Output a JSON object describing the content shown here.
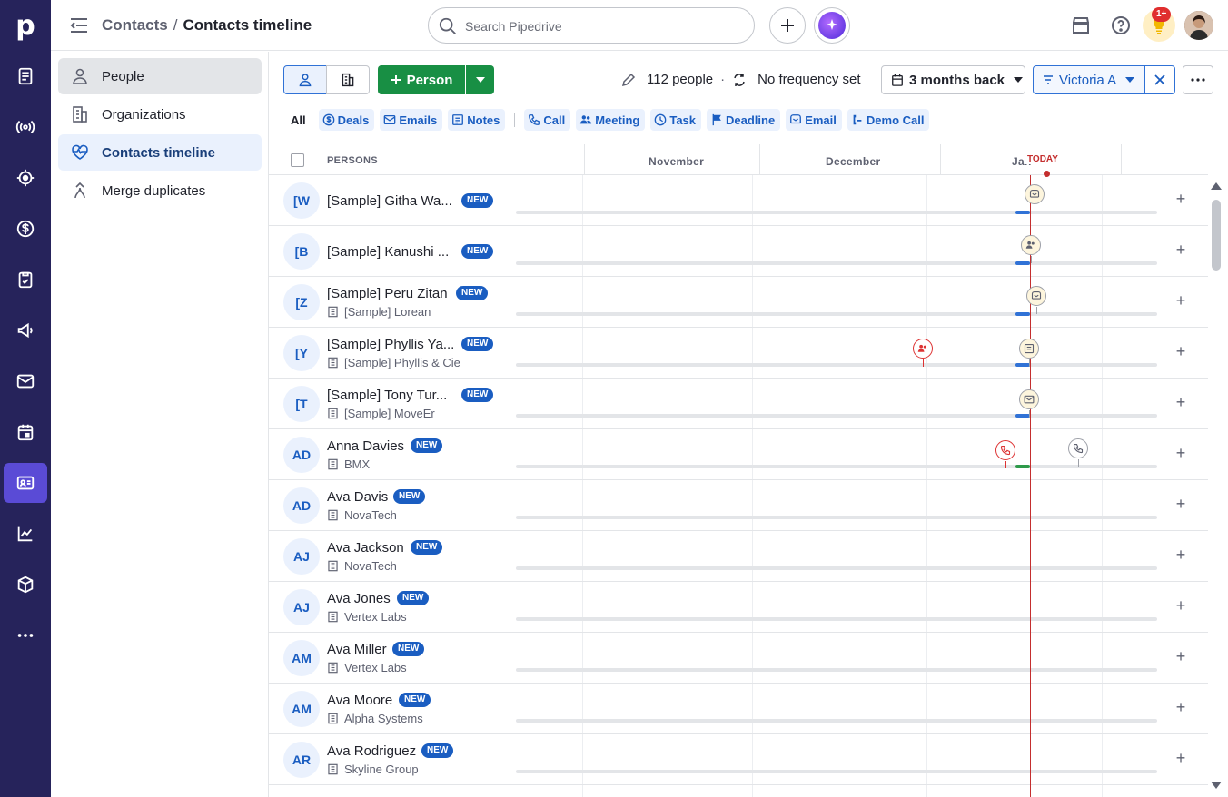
{
  "header": {
    "breadcrumb_parent": "Contacts",
    "breadcrumb_sep": "/",
    "breadcrumb_current": "Contacts timeline",
    "search_placeholder": "Search Pipedrive",
    "notifications_badge": "1+"
  },
  "sidebar": {
    "items": [
      {
        "label": "People",
        "icon": "person-icon",
        "state": "selected"
      },
      {
        "label": "Organizations",
        "icon": "building-icon",
        "state": "normal"
      },
      {
        "label": "Contacts timeline",
        "icon": "heart-pulse-icon",
        "state": "active"
      },
      {
        "label": "Merge duplicates",
        "icon": "merge-icon",
        "state": "normal"
      }
    ]
  },
  "toolbar": {
    "add_person_label": "Person",
    "people_count": "112 people",
    "frequency_label": "No frequency set",
    "period_label": "3 months back",
    "owner_filter": "Victoria A"
  },
  "activity_filters": {
    "all": "All",
    "chips": [
      "Deals",
      "Emails",
      "Notes",
      "Call",
      "Meeting",
      "Task",
      "Deadline",
      "Email",
      "Demo Call"
    ]
  },
  "table": {
    "persons_header": "PERSONS",
    "months": [
      "November",
      "December",
      "Jan"
    ],
    "today_label": "TODAY",
    "new_label": "NEW",
    "rows": [
      {
        "initials": "[W",
        "name": "[Sample] Githa Wa...",
        "org": ""
      },
      {
        "initials": "[B",
        "name": "[Sample] Kanushi ...",
        "org": ""
      },
      {
        "initials": "[Z",
        "name": "[Sample] Peru Zitan",
        "org": "[Sample] Lorean"
      },
      {
        "initials": "[Y",
        "name": "[Sample] Phyllis Ya...",
        "org": "[Sample] Phyllis & Cie"
      },
      {
        "initials": "[T",
        "name": "[Sample] Tony Tur...",
        "org": "[Sample] MoveEr"
      },
      {
        "initials": "AD",
        "name": "Anna Davies",
        "org": "BMX"
      },
      {
        "initials": "AD",
        "name": "Ava Davis",
        "org": "NovaTech"
      },
      {
        "initials": "AJ",
        "name": "Ava Jackson",
        "org": "NovaTech"
      },
      {
        "initials": "AJ",
        "name": "Ava Jones",
        "org": "Vertex Labs"
      },
      {
        "initials": "AM",
        "name": "Ava Miller",
        "org": "Vertex Labs"
      },
      {
        "initials": "AM",
        "name": "Ava Moore",
        "org": "Alpha Systems"
      },
      {
        "initials": "AR",
        "name": "Ava Rodriguez",
        "org": "Skyline Group"
      }
    ]
  },
  "colors": {
    "rail": "#26235b",
    "accent_green": "#188f44",
    "accent_blue": "#1a5dc1",
    "today_red": "#c42e2e"
  }
}
